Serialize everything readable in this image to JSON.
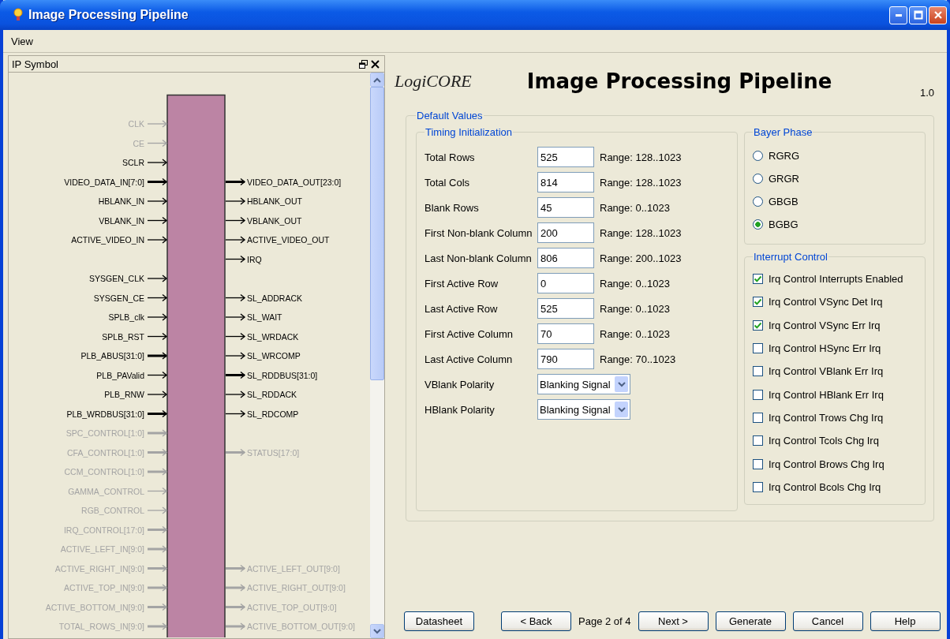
{
  "window": {
    "title": "Image Processing Pipeline"
  },
  "menu": [
    "View"
  ],
  "symbol_panel": {
    "title": "IP Symbol",
    "rows": [
      {
        "left": {
          "name": "CLK",
          "bus": false,
          "disabled": true
        }
      },
      {
        "left": {
          "name": "CE",
          "bus": false,
          "disabled": true
        }
      },
      {
        "left": {
          "name": "SCLR",
          "bus": false,
          "disabled": false
        }
      },
      {
        "left": {
          "name": "VIDEO_DATA_IN[7:0]",
          "bus": true,
          "disabled": false
        },
        "right": {
          "name": "VIDEO_DATA_OUT[23:0]",
          "bus": true,
          "disabled": false
        }
      },
      {
        "left": {
          "name": "HBLANK_IN",
          "bus": false,
          "disabled": false
        },
        "right": {
          "name": "HBLANK_OUT",
          "bus": false,
          "disabled": false
        }
      },
      {
        "left": {
          "name": "VBLANK_IN",
          "bus": false,
          "disabled": false
        },
        "right": {
          "name": "VBLANK_OUT",
          "bus": false,
          "disabled": false
        }
      },
      {
        "left": {
          "name": "ACTIVE_VIDEO_IN",
          "bus": false,
          "disabled": false
        },
        "right": {
          "name": "ACTIVE_VIDEO_OUT",
          "bus": false,
          "disabled": false
        }
      },
      {
        "right": {
          "name": "IRQ",
          "bus": false,
          "disabled": false
        }
      },
      {
        "left": {
          "name": "SYSGEN_CLK",
          "bus": false,
          "disabled": false
        }
      },
      {
        "left": {
          "name": "SYSGEN_CE",
          "bus": false,
          "disabled": false
        },
        "right": {
          "name": "SL_ADDRACK",
          "bus": false,
          "disabled": false
        }
      },
      {
        "left": {
          "name": "SPLB_clk",
          "bus": false,
          "disabled": false
        },
        "right": {
          "name": "SL_WAIT",
          "bus": false,
          "disabled": false
        }
      },
      {
        "left": {
          "name": "SPLB_RST",
          "bus": false,
          "disabled": false
        },
        "right": {
          "name": "SL_WRDACK",
          "bus": false,
          "disabled": false
        }
      },
      {
        "left": {
          "name": "PLB_ABUS[31:0]",
          "bus": true,
          "disabled": false
        },
        "right": {
          "name": "SL_WRCOMP",
          "bus": false,
          "disabled": false
        }
      },
      {
        "left": {
          "name": "PLB_PAValid",
          "bus": false,
          "disabled": false
        },
        "right": {
          "name": "SL_RDDBUS[31:0]",
          "bus": true,
          "disabled": false
        }
      },
      {
        "left": {
          "name": "PLB_RNW",
          "bus": false,
          "disabled": false
        },
        "right": {
          "name": "SL_RDDACK",
          "bus": false,
          "disabled": false
        }
      },
      {
        "left": {
          "name": "PLB_WRDBUS[31:0]",
          "bus": true,
          "disabled": false
        },
        "right": {
          "name": "SL_RDCOMP",
          "bus": false,
          "disabled": false
        }
      },
      {
        "left": {
          "name": "SPC_CONTROL[1:0]",
          "bus": true,
          "disabled": true
        }
      },
      {
        "left": {
          "name": "CFA_CONTROL[1:0]",
          "bus": true,
          "disabled": true
        },
        "right": {
          "name": "STATUS[17:0]",
          "bus": true,
          "disabled": true
        }
      },
      {
        "left": {
          "name": "CCM_CONTROL[1:0]",
          "bus": true,
          "disabled": true
        }
      },
      {
        "left": {
          "name": "GAMMA_CONTROL",
          "bus": false,
          "disabled": true
        }
      },
      {
        "left": {
          "name": "RGB_CONTROL",
          "bus": false,
          "disabled": true
        }
      },
      {
        "left": {
          "name": "IRQ_CONTROL[17:0]",
          "bus": true,
          "disabled": true
        }
      },
      {
        "left": {
          "name": "ACTIVE_LEFT_IN[9:0]",
          "bus": true,
          "disabled": true
        }
      },
      {
        "left": {
          "name": "ACTIVE_RIGHT_IN[9:0]",
          "bus": true,
          "disabled": true
        },
        "right": {
          "name": "ACTIVE_LEFT_OUT[9:0]",
          "bus": true,
          "disabled": true
        }
      },
      {
        "left": {
          "name": "ACTIVE_TOP_IN[9:0]",
          "bus": true,
          "disabled": true
        },
        "right": {
          "name": "ACTIVE_RIGHT_OUT[9:0]",
          "bus": true,
          "disabled": true
        }
      },
      {
        "left": {
          "name": "ACTIVE_BOTTOM_IN[9:0]",
          "bus": true,
          "disabled": true
        },
        "right": {
          "name": "ACTIVE_TOP_OUT[9:0]",
          "bus": true,
          "disabled": true
        }
      },
      {
        "left": {
          "name": "TOTAL_ROWS_IN[9:0]",
          "bus": true,
          "disabled": true
        },
        "right": {
          "name": "ACTIVE_BOTTOM_OUT[9:0]",
          "bus": true,
          "disabled": true
        }
      }
    ]
  },
  "header": {
    "logo": "LogiCORE",
    "title": "Image Processing Pipeline",
    "version": "1.0"
  },
  "default_values": {
    "legend": "Default Values",
    "timing": {
      "legend": "Timing Initialization",
      "fields": [
        {
          "kind": "text",
          "label": "Total Rows",
          "value": "525",
          "range": "Range: 128..1023"
        },
        {
          "kind": "text",
          "label": "Total Cols",
          "value": "814",
          "range": "Range: 128..1023"
        },
        {
          "kind": "text",
          "label": "Blank Rows",
          "value": "45",
          "range": "Range: 0..1023"
        },
        {
          "kind": "text",
          "label": "First Non-blank Column",
          "value": "200",
          "range": "Range: 128..1023"
        },
        {
          "kind": "text",
          "label": "Last Non-blank Column",
          "value": "806",
          "range": "Range: 200..1023"
        },
        {
          "kind": "text",
          "label": "First Active Row",
          "value": "0",
          "range": "Range: 0..1023"
        },
        {
          "kind": "text",
          "label": "Last Active Row",
          "value": "525",
          "range": "Range: 0..1023"
        },
        {
          "kind": "text",
          "label": "First Active Column",
          "value": "70",
          "range": "Range: 0..1023"
        },
        {
          "kind": "text",
          "label": "Last Active Column",
          "value": "790",
          "range": "Range: 70..1023"
        },
        {
          "kind": "select",
          "label": "VBlank Polarity",
          "value": "Blanking Signal"
        },
        {
          "kind": "select",
          "label": "HBlank Polarity",
          "value": "Blanking Signal"
        }
      ]
    },
    "bayer_phase": {
      "legend": "Bayer Phase",
      "options": [
        {
          "label": "RGRG",
          "selected": false
        },
        {
          "label": "GRGR",
          "selected": false
        },
        {
          "label": "GBGB",
          "selected": false
        },
        {
          "label": "BGBG",
          "selected": true
        }
      ]
    },
    "interrupt_control": {
      "legend": "Interrupt Control",
      "items": [
        {
          "label": "Irq Control Interrupts Enabled",
          "checked": true
        },
        {
          "label": "Irq Control VSync Det Irq",
          "checked": true
        },
        {
          "label": "Irq Control VSync Err Irq",
          "checked": true
        },
        {
          "label": "Irq Control HSync Err Irq",
          "checked": false
        },
        {
          "label": "Irq Control VBlank Err Irq",
          "checked": false
        },
        {
          "label": "Irq Control HBlank Err Irq",
          "checked": false
        },
        {
          "label": "Irq Control Trows Chg Irq",
          "checked": false
        },
        {
          "label": "Irq Control Tcols Chg Irq",
          "checked": false
        },
        {
          "label": "Irq Control Brows Chg Irq",
          "checked": false
        },
        {
          "label": "Irq Control Bcols Chg Irq",
          "checked": false
        }
      ]
    }
  },
  "footer": {
    "datasheet": "Datasheet",
    "back": "< Back",
    "page": "Page 2 of 4",
    "buttons": [
      "Next >",
      "Generate",
      "Cancel",
      "Help"
    ]
  }
}
